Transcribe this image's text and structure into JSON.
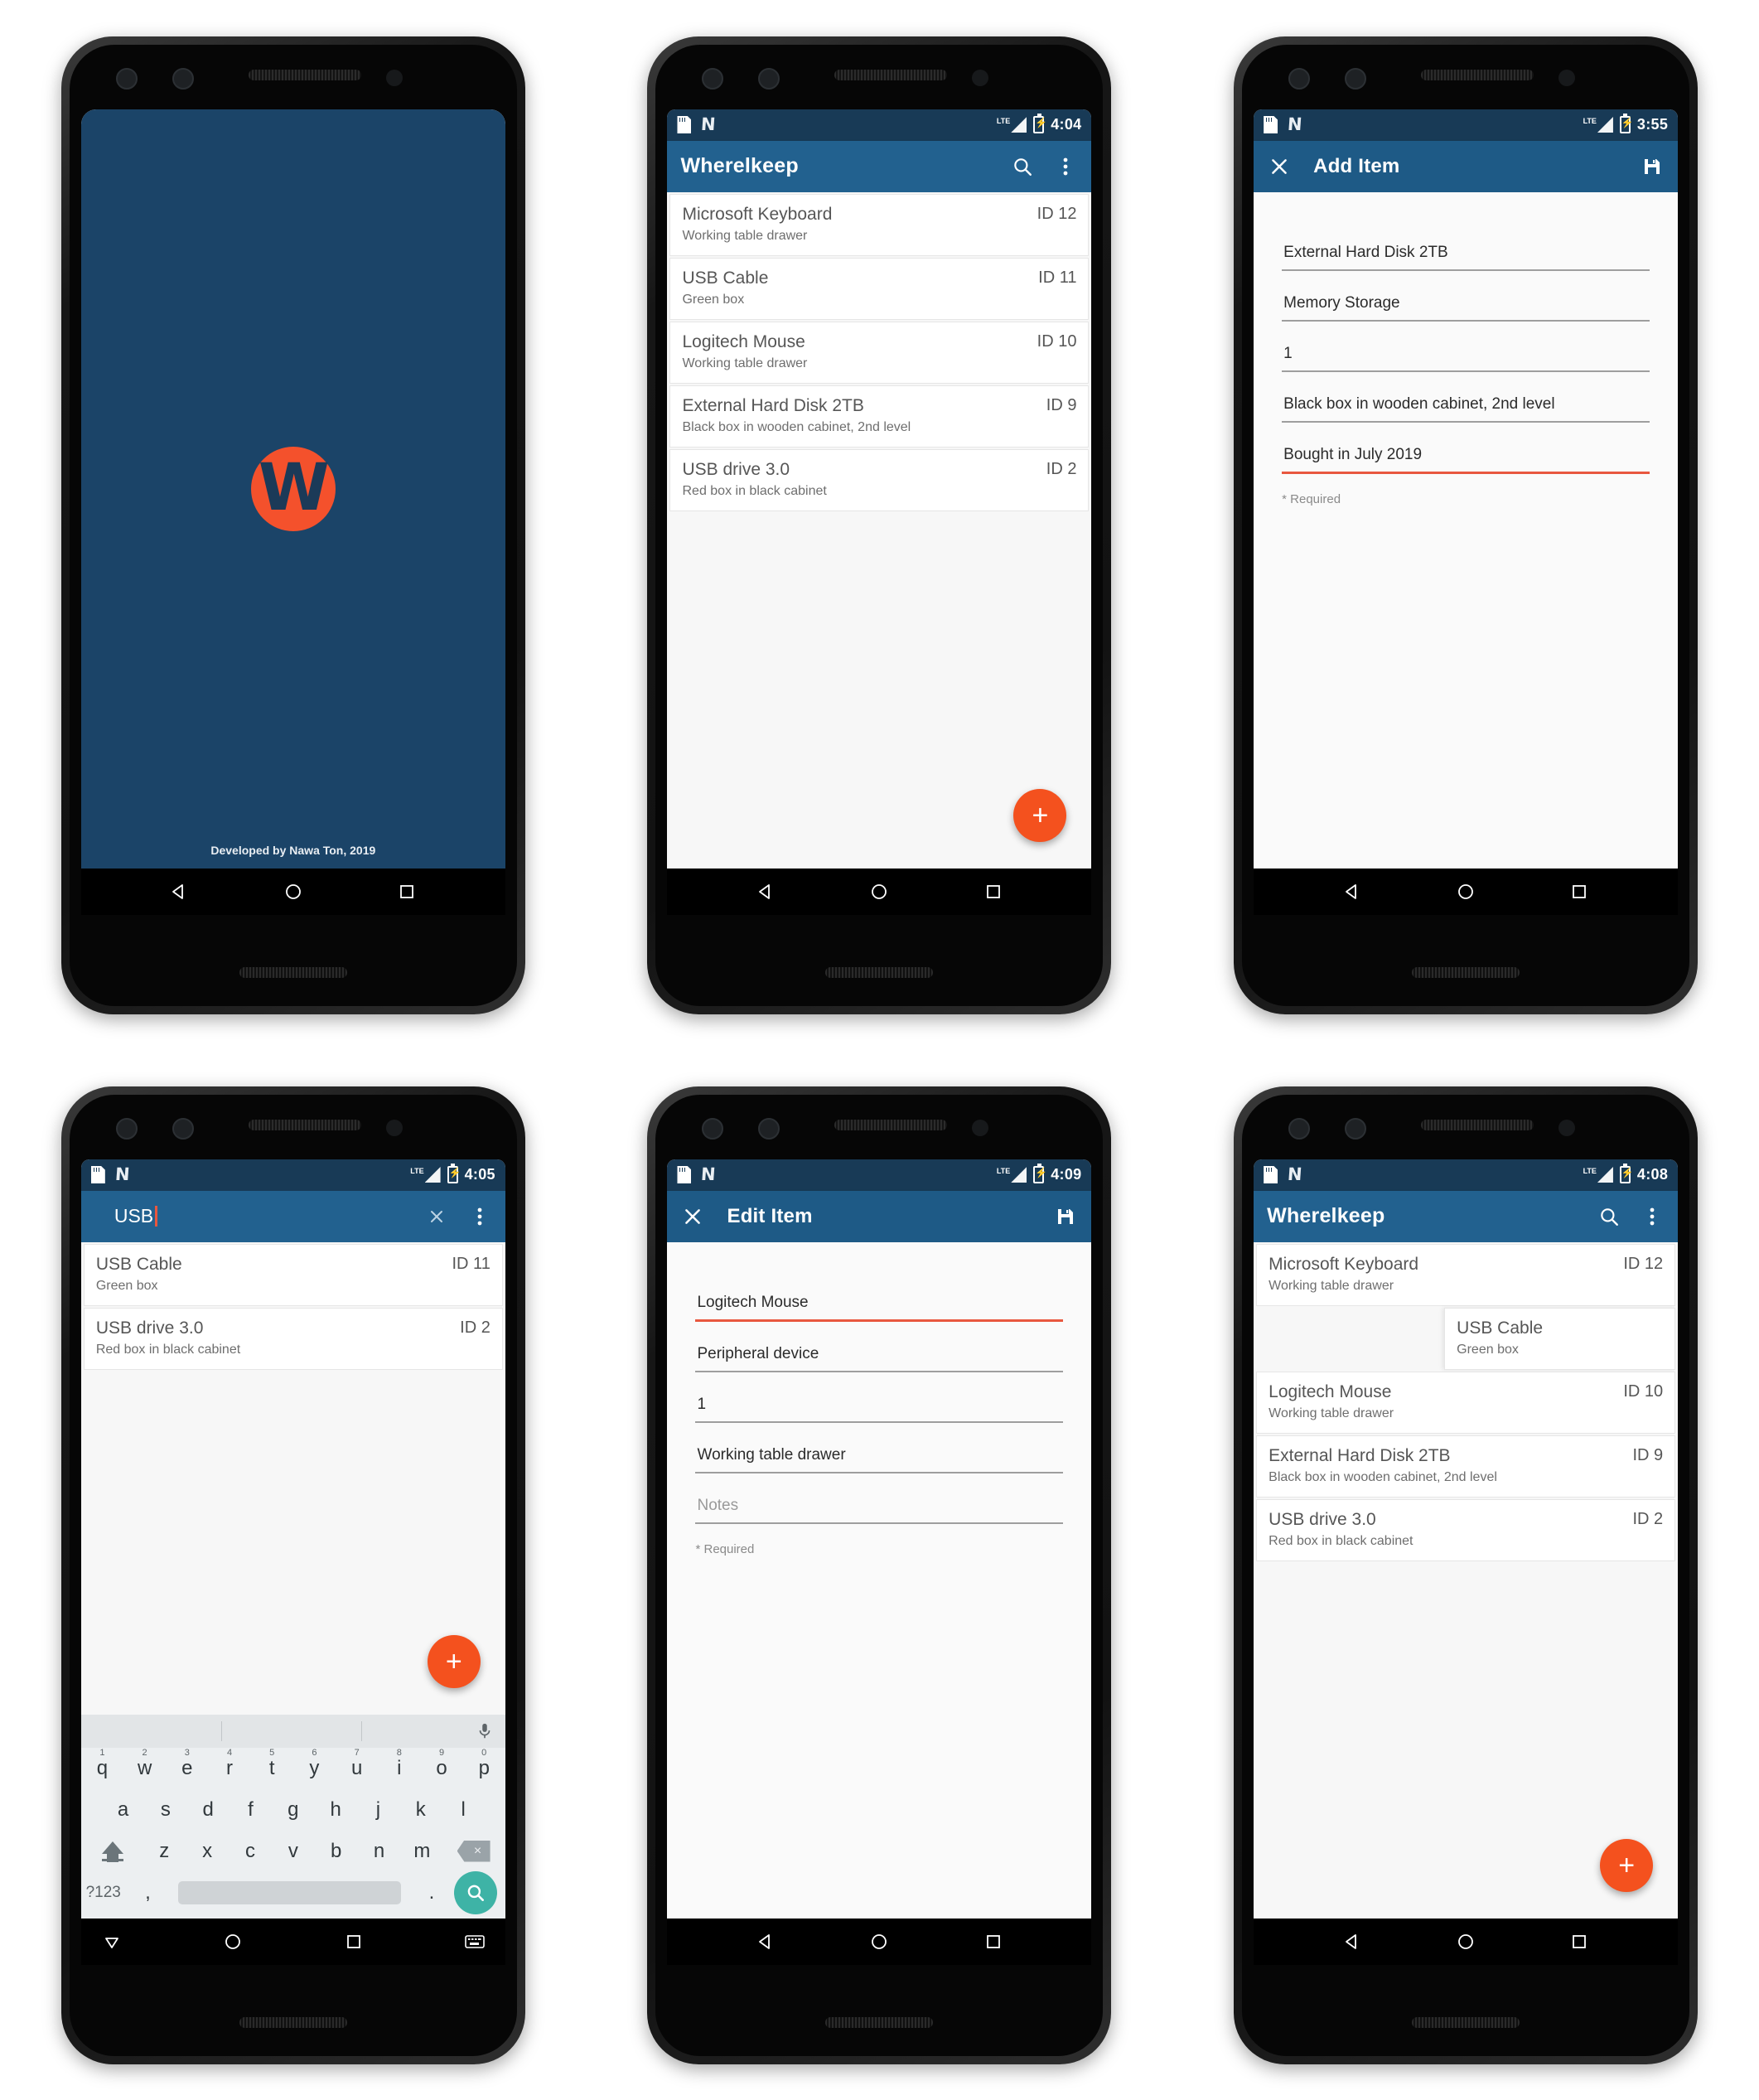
{
  "app": {
    "name": "Wherelkeep",
    "accent_orange": "#f4511e",
    "accent_blue": "#22618f",
    "splash_bg": "#1b4468",
    "focus_red": "#e8573f",
    "enter_teal": "#3eb3a6"
  },
  "screens": [
    {
      "id": "splash",
      "type": "splash",
      "logo_letter": "W",
      "credit": "Developed by Nawa Ton, 2019"
    },
    {
      "id": "list",
      "type": "list",
      "statusbar": {
        "time": "4:04",
        "network": "LTE"
      },
      "appbar": {
        "title": "Wherelkeep"
      },
      "items": [
        {
          "title": "Microsoft Keyboard",
          "sub": "Working table drawer",
          "id": "ID 12"
        },
        {
          "title": "USB Cable",
          "sub": "Green box",
          "id": "ID 11"
        },
        {
          "title": "Logitech Mouse",
          "sub": "Working table drawer",
          "id": "ID 10"
        },
        {
          "title": "External Hard Disk 2TB",
          "sub": "Black box in wooden cabinet, 2nd level",
          "id": "ID 9"
        },
        {
          "title": "USB drive 3.0",
          "sub": "Red box in black cabinet",
          "id": "ID 2"
        }
      ],
      "fab_label": "+"
    },
    {
      "id": "add",
      "type": "form",
      "statusbar": {
        "time": "3:55",
        "network": "LTE"
      },
      "appbar": {
        "title": "Add Item"
      },
      "fields": [
        {
          "value": "External Hard Disk 2TB",
          "focused": false,
          "placeholder": false
        },
        {
          "value": "Memory Storage",
          "focused": false,
          "placeholder": false
        },
        {
          "value": "1",
          "focused": false,
          "placeholder": false
        },
        {
          "value": "Black box in wooden cabinet, 2nd level",
          "focused": false,
          "placeholder": false
        },
        {
          "value": "Bought in July 2019",
          "focused": true,
          "placeholder": false
        }
      ],
      "required_note": "* Required"
    },
    {
      "id": "search",
      "type": "search",
      "statusbar": {
        "time": "4:05",
        "network": "LTE"
      },
      "search": {
        "query": "USB",
        "placeholder": "Search"
      },
      "items": [
        {
          "title": "USB Cable",
          "sub": "Green box",
          "id": "ID 11"
        },
        {
          "title": "USB drive 3.0",
          "sub": "Red box in black cabinet",
          "id": "ID 2"
        }
      ],
      "fab_label": "+",
      "keyboard": {
        "row1": [
          {
            "k": "q",
            "n": "1"
          },
          {
            "k": "w",
            "n": "2"
          },
          {
            "k": "e",
            "n": "3"
          },
          {
            "k": "r",
            "n": "4"
          },
          {
            "k": "t",
            "n": "5"
          },
          {
            "k": "y",
            "n": "6"
          },
          {
            "k": "u",
            "n": "7"
          },
          {
            "k": "i",
            "n": "8"
          },
          {
            "k": "o",
            "n": "9"
          },
          {
            "k": "p",
            "n": "0"
          }
        ],
        "row2": [
          "a",
          "s",
          "d",
          "f",
          "g",
          "h",
          "j",
          "k",
          "l"
        ],
        "row3": [
          "z",
          "x",
          "c",
          "v",
          "b",
          "n",
          "m"
        ],
        "symbols_key": "?123",
        "comma_key": ",",
        "period_key": "."
      }
    },
    {
      "id": "edit",
      "type": "form",
      "statusbar": {
        "time": "4:09",
        "network": "LTE"
      },
      "appbar": {
        "title": "Edit Item"
      },
      "fields": [
        {
          "value": "Logitech Mouse",
          "focused": true,
          "placeholder": false
        },
        {
          "value": "Peripheral device",
          "focused": false,
          "placeholder": false
        },
        {
          "value": "1",
          "focused": false,
          "placeholder": false
        },
        {
          "value": "Working table drawer",
          "focused": false,
          "placeholder": false
        },
        {
          "value": "Notes",
          "focused": false,
          "placeholder": true
        }
      ],
      "required_note": "* Required"
    },
    {
      "id": "swipe",
      "type": "list",
      "statusbar": {
        "time": "4:08",
        "network": "LTE"
      },
      "appbar": {
        "title": "Wherelkeep"
      },
      "items": [
        {
          "title": "Microsoft Keyboard",
          "sub": "Working table drawer",
          "id": "ID 12",
          "swiped": false
        },
        {
          "title": "USB Cable",
          "sub": "Green box",
          "id": "",
          "swiped": true
        },
        {
          "title": "Logitech Mouse",
          "sub": "Working table drawer",
          "id": "ID 10",
          "swiped": false
        },
        {
          "title": "External Hard Disk 2TB",
          "sub": "Black box in wooden cabinet, 2nd level",
          "id": "ID 9",
          "swiped": false
        },
        {
          "title": "USB drive 3.0",
          "sub": "Red box in black cabinet",
          "id": "ID 2",
          "swiped": false
        }
      ],
      "fab_label": "+"
    }
  ]
}
